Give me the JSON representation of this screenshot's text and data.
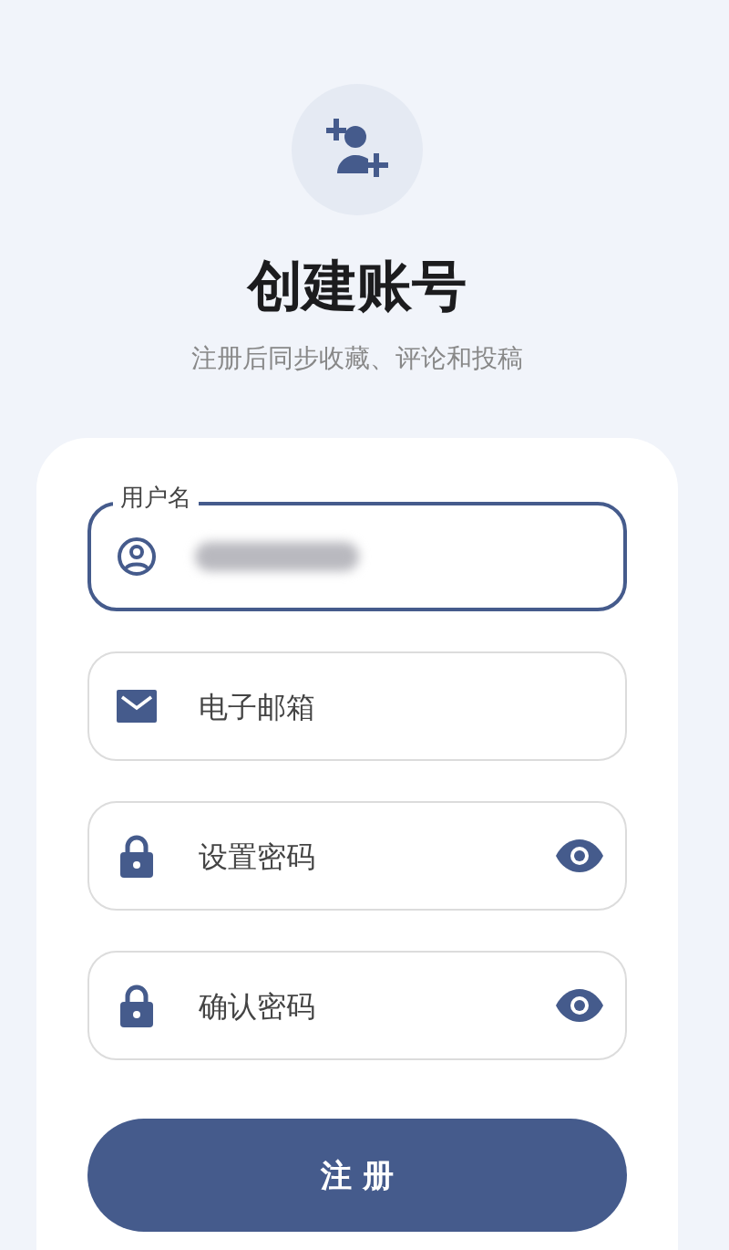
{
  "header": {
    "title": "创建账号",
    "subtitle": "注册后同步收藏、评论和投稿"
  },
  "fields": [
    {
      "kind": "user",
      "label": "用户名",
      "focused": true,
      "blurred_value": true,
      "reveal_toggle": false
    },
    {
      "kind": "email",
      "placeholder": "电子邮箱",
      "focused": false,
      "blurred_value": false,
      "reveal_toggle": false
    },
    {
      "kind": "password",
      "placeholder": "设置密码",
      "focused": false,
      "blurred_value": false,
      "reveal_toggle": true
    },
    {
      "kind": "password",
      "placeholder": "确认密码",
      "focused": false,
      "blurred_value": false,
      "reveal_toggle": true
    }
  ],
  "submit": {
    "label": "注 册"
  }
}
